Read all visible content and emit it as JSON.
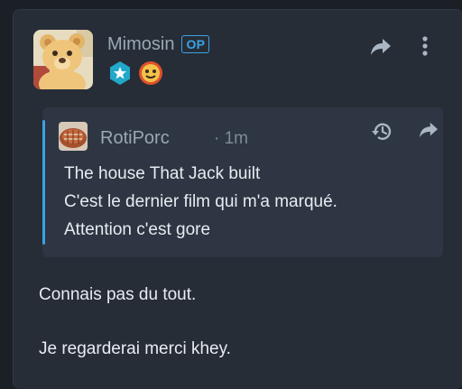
{
  "post": {
    "author": "Mimosin",
    "op_label": "OP",
    "badges": [
      "verified-star-badge-icon",
      "emoji-sticker-badge-icon"
    ],
    "actions": [
      "share-icon",
      "more-options-icon"
    ]
  },
  "quote": {
    "author": "RotiPorc",
    "time": "· 1m",
    "lines": [
      "The house That Jack built",
      "C'est le dernier film qui m'a marqué.",
      "Attention c'est gore"
    ],
    "actions": [
      "history-icon",
      "share-icon"
    ]
  },
  "body": {
    "lines": [
      "Connais pas du tout.",
      "Je regarderai merci khey."
    ]
  },
  "colors": {
    "background": "#1b2027",
    "card": "#262d37",
    "quote_card": "#2e3643",
    "accent": "#3ca3e4",
    "text": "#e8ecf1",
    "muted": "#9aa7b5"
  }
}
